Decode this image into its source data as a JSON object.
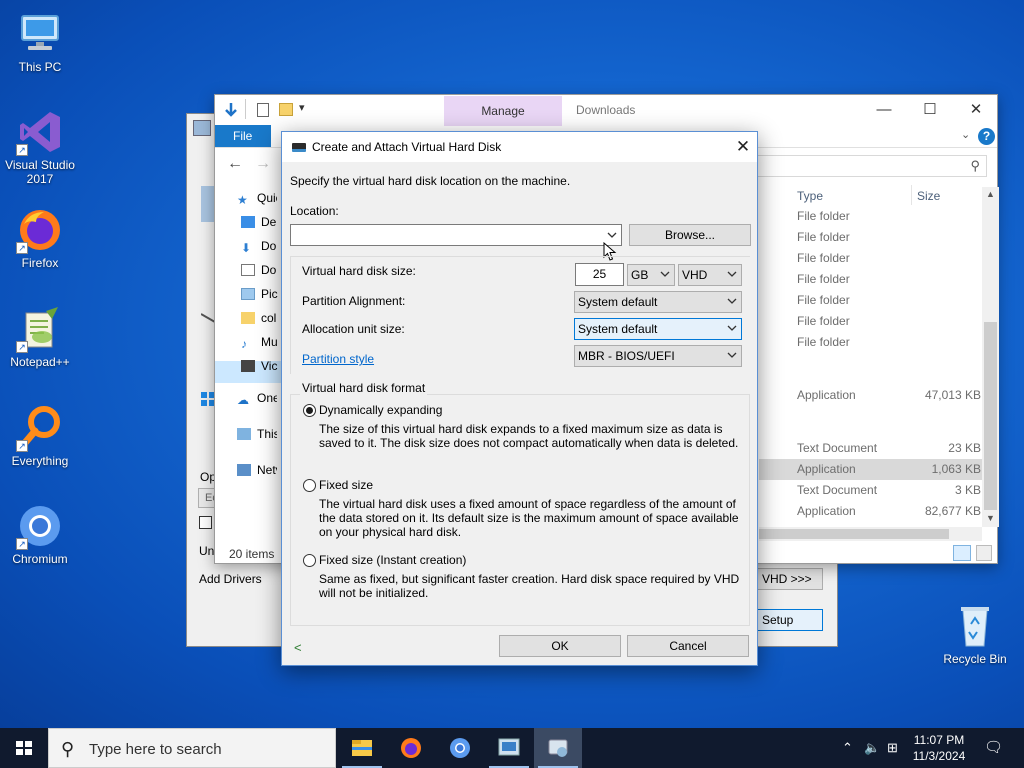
{
  "desktop": {
    "icons": [
      {
        "label": "This PC"
      },
      {
        "label": "Visual Studio 2017"
      },
      {
        "label": "Firefox"
      },
      {
        "label": "Notepad++"
      },
      {
        "label": "Everything"
      },
      {
        "label": "Chromium"
      },
      {
        "label": "Recycle Bin"
      }
    ]
  },
  "setup_window": {
    "op_label": "Op",
    "un_label": "Un",
    "add_drivers": "Add Drivers",
    "vhd_button": "VHD >>>",
    "setup_button": "Setup",
    "ec_field": "Ec"
  },
  "explorer": {
    "manage_tab": "Manage",
    "title": "Downloads",
    "file_tab": "File",
    "help": "?",
    "nav": [
      {
        "label": "Quic"
      },
      {
        "label": "De"
      },
      {
        "label": "Do"
      },
      {
        "label": "Do"
      },
      {
        "label": "Pic"
      },
      {
        "label": "col"
      },
      {
        "label": "Mu"
      },
      {
        "label": "Vic"
      },
      {
        "label": "One"
      },
      {
        "label": "This"
      },
      {
        "label": "Netv"
      }
    ],
    "status": "20 items",
    "columns": {
      "type": "Type",
      "size": "Size"
    },
    "rows": [
      {
        "type": "File folder",
        "size": ""
      },
      {
        "type": "File folder",
        "size": ""
      },
      {
        "type": "File folder",
        "size": ""
      },
      {
        "type": "File folder",
        "size": ""
      },
      {
        "type": "File folder",
        "size": ""
      },
      {
        "type": "File folder",
        "size": ""
      },
      {
        "type": "File folder",
        "size": ""
      },
      {
        "type": "Application",
        "size": "47,013 KB"
      },
      {
        "type": "Text Document",
        "size": "23 KB"
      },
      {
        "type": "Application",
        "size": "1,063 KB"
      },
      {
        "type": "Text Document",
        "size": "3 KB"
      },
      {
        "type": "Application",
        "size": "82,677 KB"
      }
    ]
  },
  "dialog": {
    "title": "Create and Attach Virtual Hard Disk",
    "instruction": "Specify the virtual hard disk location on the machine.",
    "location_label": "Location:",
    "location_value": "",
    "browse_button": "Browse...",
    "size_label": "Virtual hard disk size:",
    "size_value": "25",
    "size_unit": "GB",
    "disk_type": "VHD",
    "partition_alignment_label": "Partition Alignment:",
    "partition_alignment_value": "System default",
    "allocation_unit_label": "Allocation unit size:",
    "allocation_unit_value": "System default",
    "partition_style_link": "Partition style",
    "partition_style_value": "MBR - BIOS/UEFI",
    "format_group": "Virtual hard disk format",
    "options": [
      {
        "label": "Dynamically expanding",
        "selected": true,
        "description": "The size of this virtual hard disk expands to a fixed maximum size as data is saved to it. The disk size does not compact automatically when data is deleted."
      },
      {
        "label": "Fixed size",
        "selected": false,
        "description": "The virtual hard disk uses a fixed amount of space regardless of the amount of the data stored on it. Its default size is the maximum amount of space available on your physical hard disk."
      },
      {
        "label": "Fixed size (Instant creation)",
        "selected": false,
        "description": "Same as fixed, but significant faster creation. Hard disk space required by VHD will not be initialized."
      }
    ],
    "back_link": "<",
    "ok_button": "OK",
    "cancel_button": "Cancel"
  },
  "taskbar": {
    "search_placeholder": "Type here to search",
    "time": "11:07 PM",
    "date": "11/3/2024"
  },
  "colors": {
    "accent": "#0078d7",
    "desktop": "#1466d0",
    "taskbar": "#101a2e",
    "manage_tab": "#e9d6f5"
  }
}
